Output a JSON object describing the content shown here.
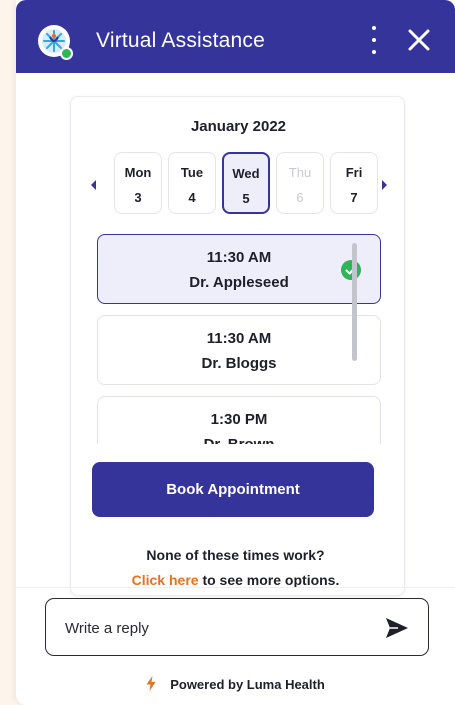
{
  "header": {
    "title": "Virtual Assistance",
    "logo_icon": "luma-health-logo-icon",
    "status_color": "#2fb457",
    "menu_icon": "vertical-dots-icon",
    "close_icon": "close-icon"
  },
  "calendar": {
    "month": "January 2022",
    "days": [
      {
        "name": "Mon",
        "num": "3",
        "state": "normal"
      },
      {
        "name": "Tue",
        "num": "4",
        "state": "normal"
      },
      {
        "name": "Wed",
        "num": "5",
        "state": "selected"
      },
      {
        "name": "Thu",
        "num": "6",
        "state": "disabled"
      },
      {
        "name": "Fri",
        "num": "7",
        "state": "normal"
      }
    ]
  },
  "slots": [
    {
      "time": "11:30 AM",
      "doctor": "Dr. Appleseed",
      "selected": true
    },
    {
      "time": "11:30 AM",
      "doctor": "Dr. Bloggs",
      "selected": false
    },
    {
      "time": "1:30 PM",
      "doctor": "Dr. Brown",
      "selected": false
    }
  ],
  "actions": {
    "book_label": "Book Appointment",
    "none_text": "None of these times work?",
    "click_here": "Click here",
    "more_options": " to see more options."
  },
  "reply": {
    "placeholder": "Write a reply",
    "send_icon": "send-icon"
  },
  "footer": {
    "powered_by": "Powered by Luma Health"
  },
  "colors": {
    "brand": "#35349a",
    "accent": "#e8711f",
    "selected_bg": "#eeeefb",
    "check": "#2fb457"
  }
}
